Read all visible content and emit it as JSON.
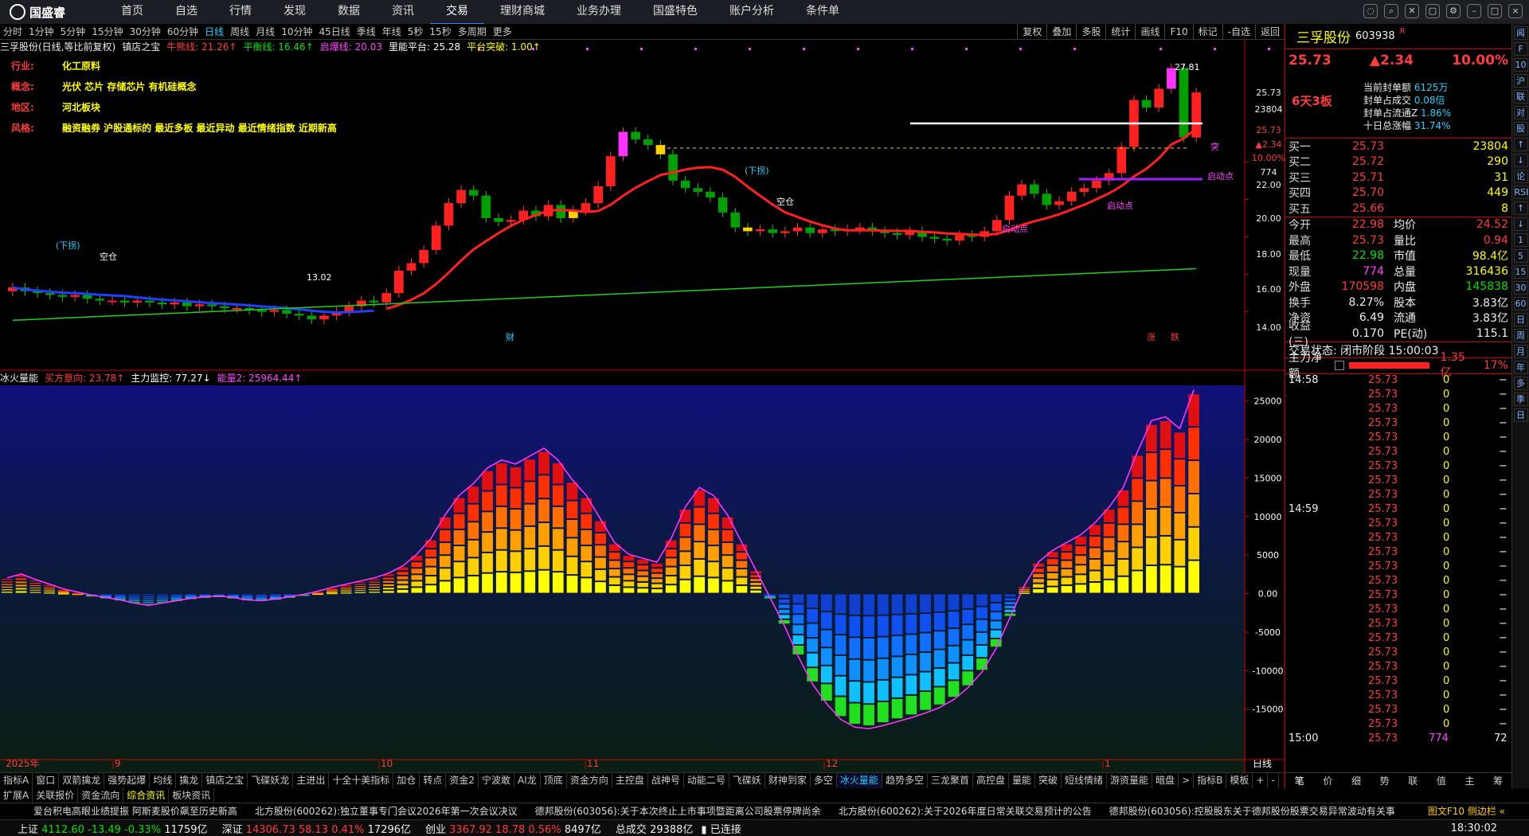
{
  "app": {
    "logo": "国盛睿"
  },
  "menu": [
    "首页",
    "自选",
    "行情",
    "发现",
    "数据",
    "资讯",
    "交易",
    "理财商城",
    "业务办理",
    "国盛特色",
    "账户分析",
    "条件单"
  ],
  "periods": [
    "分时",
    "1分钟",
    "5分钟",
    "15分钟",
    "30分钟",
    "60分钟",
    "日线",
    "周线",
    "月线",
    "10分钟",
    "45日线",
    "季线",
    "年线",
    "5秒",
    "15秒",
    "多周期",
    "更多"
  ],
  "right_tools": [
    "复权",
    "叠加",
    "多股",
    "统计",
    "画线",
    "F10",
    "标记",
    "-自选",
    "返回"
  ],
  "indicator1": {
    "name": "三孚股份(日线,等比前复权)",
    "addon": "镇店之宝",
    "lines": [
      {
        "label": "牛熊线: 21.26↑",
        "color": "#ff3b3b"
      },
      {
        "label": "平衡线: 16.46↑",
        "color": "#00e000"
      },
      {
        "label": "启爆线: 20.03",
        "color": "#ff44ff"
      },
      {
        "label": "里能平台: 25.28",
        "color": "#ffffff"
      },
      {
        "label": "平台突破: 1.00↑",
        "color": "#ffff00"
      }
    ]
  },
  "info": [
    {
      "k": "行业:",
      "v": "化工原料"
    },
    {
      "k": "概念:",
      "v": "光伏 芯片 存储芯片 有机硅概念"
    },
    {
      "k": "地区:",
      "v": "河北板块"
    },
    {
      "k": "风格:",
      "v": "融资融券 沪股通标的 最近多板 最近异动 最近情绪指数 近期新高"
    }
  ],
  "indicator2": {
    "name": "冰火量能",
    "lines": [
      {
        "label": "买方意向: 23.78↑",
        "color": "#ff3b3b"
      },
      {
        "label": "主力监控: 77.27↓",
        "color": "#ffffff"
      },
      {
        "label": "能量2: 25964.44↑",
        "color": "#ff44ff"
      }
    ]
  },
  "price_axis": [
    "25.73",
    "23804",
    "25.73",
    "▲2.34",
    "10.00%",
    "774",
    "22.00",
    "20.00",
    "18.00",
    "16.00",
    "14.00"
  ],
  "vol_axis": [
    "25000",
    "20000",
    "15000",
    "10000",
    "5000",
    "0.00",
    "-5000",
    "-10000",
    "-15000"
  ],
  "date_axis": [
    "2025年",
    "9",
    "10",
    "11",
    "12",
    "1",
    "日线"
  ],
  "chart_labels": {
    "high": "27.81",
    "low": "13.02",
    "downbreak1": "(下拐)",
    "downbreak2": "(下拐)",
    "empty1": "空仓",
    "empty2": "空仓",
    "start": "启动点",
    "start2": "启动点",
    "start3": "启动点",
    "tu": "突",
    "zhang": "涨",
    "die": "跌",
    "cai": "财",
    "gain_tag": "6天3板"
  },
  "chart_data": {
    "type": "candlestick",
    "title": "三孚股份(日线,等比前复权)",
    "ylim": [
      12.5,
      28
    ],
    "y_ticks": [
      14,
      16,
      18,
      20,
      22
    ],
    "closes": [
      15.3,
      15.1,
      15.0,
      14.9,
      14.8,
      14.9,
      14.7,
      14.6,
      14.6,
      14.5,
      14.6,
      14.5,
      14.4,
      14.5,
      14.3,
      14.4,
      14.3,
      14.2,
      14.2,
      14.1,
      14.0,
      14.1,
      13.9,
      13.8,
      13.6,
      13.8,
      14.0,
      14.3,
      14.6,
      14.5,
      15.0,
      16.2,
      16.6,
      17.3,
      18.6,
      19.8,
      20.5,
      20.2,
      19.0,
      18.8,
      18.9,
      19.4,
      19.1,
      19.7,
      19.0,
      19.4,
      19.8,
      20.7,
      22.3,
      23.6,
      23.2,
      22.9,
      22.4,
      21.0,
      20.6,
      20.4,
      20.1,
      19.3,
      18.5,
      18.3,
      18.4,
      18.2,
      18.3,
      18.5,
      18.2,
      18.4,
      18.3,
      18.4,
      18.5,
      18.3,
      18.2,
      18.1,
      18.3,
      18.0,
      17.9,
      17.8,
      18.1,
      18.0,
      18.3,
      18.9,
      20.2,
      20.8,
      20.3,
      19.7,
      19.9,
      20.4,
      20.6,
      21.0,
      21.4,
      22.8,
      25.3,
      24.9,
      25.9,
      27.0,
      23.3,
      25.7
    ],
    "energy": {
      "type": "bar",
      "x_label": "日线",
      "ylim": [
        -20000,
        26000
      ],
      "values": [
        2000,
        2500,
        1800,
        1200,
        600,
        200,
        -200,
        -500,
        -800,
        -1200,
        -1500,
        -1200,
        -900,
        -600,
        -400,
        -300,
        -500,
        -800,
        -900,
        -700,
        -400,
        -100,
        300,
        800,
        1200,
        1600,
        2000,
        2600,
        3500,
        5000,
        7000,
        10000,
        12500,
        14000,
        16000,
        17000,
        16500,
        17500,
        18500,
        17000,
        14500,
        12500,
        9500,
        6500,
        5000,
        4500,
        4000,
        7000,
        11000,
        13500,
        12500,
        10000,
        6500,
        3000,
        -500,
        -4000,
        -8000,
        -11500,
        -14000,
        -16000,
        -17000,
        -17200,
        -16800,
        -16300,
        -15800,
        -15200,
        -14500,
        -13500,
        -12000,
        -10000,
        -7000,
        -3000,
        1000,
        4000,
        5500,
        6500,
        7500,
        9000,
        11000,
        13500,
        18000,
        22000,
        22500,
        21000,
        25964
      ],
      "series": [
        {
          "name": "能量2",
          "last": 25964.44
        }
      ]
    }
  },
  "quote": {
    "name": "三孚股份",
    "code": "603938",
    "tag": "R",
    "price": "25.73",
    "change": "▲2.34",
    "pct": "10.00%",
    "seal": [
      {
        "k": "当前封单额",
        "v": "6125万"
      },
      {
        "k": "封单占成交",
        "v": "0.08倍"
      },
      {
        "k": "封单占流通Z",
        "v": "1.86%"
      },
      {
        "k": "十日总涨幅",
        "v": "31.74%"
      }
    ],
    "board": "6天3板",
    "book": [
      {
        "k": "买一",
        "p": "25.73",
        "v": "23804"
      },
      {
        "k": "买二",
        "p": "25.72",
        "v": "290"
      },
      {
        "k": "买三",
        "p": "25.71",
        "v": "31"
      },
      {
        "k": "买四",
        "p": "25.70",
        "v": "449"
      },
      {
        "k": "买五",
        "p": "25.66",
        "v": "8"
      }
    ],
    "stats": [
      {
        "a": "今开",
        "av": "22.98",
        "b": "均价",
        "bv": "24.52"
      },
      {
        "a": "最高",
        "av": "25.73",
        "b": "量比",
        "bv": "0.94"
      },
      {
        "a": "最低",
        "av": "22.98",
        "b": "市值",
        "bv": "98.4亿"
      },
      {
        "a": "现量",
        "av": "774",
        "b": "总量",
        "bv": "316436"
      },
      {
        "a": "外盘",
        "av": "170598",
        "b": "内盘",
        "bv": "145838"
      },
      {
        "a": "换手",
        "av": "8.27%",
        "b": "股本",
        "bv": "3.83亿"
      },
      {
        "a": "净资",
        "av": "6.49",
        "b": "流通",
        "bv": "3.83亿"
      },
      {
        "a": "收益(三)",
        "av": "0.170",
        "b": "PE(动)",
        "bv": "115.1"
      }
    ],
    "trade_state": "交易状态: 闭市阶段 15:00:03",
    "mainflow": {
      "k": "主力净额",
      "v": "1.35亿",
      "p": "17%"
    },
    "ticks_time": [
      "14:58",
      "14:59",
      "15:00"
    ],
    "tick_price": "25.73",
    "tick_vol": "0",
    "last_tick": {
      "p": "25.73",
      "v": "774",
      "n": "72"
    },
    "bottom_tabs": [
      "笔",
      "价",
      "细",
      "势",
      "联",
      "值",
      "主",
      "筹"
    ]
  },
  "sidebar": [
    "闻",
    "F",
    "10",
    "沪",
    "联",
    "对",
    "股",
    "↑",
    "↓",
    "论",
    "RSI",
    "↑",
    "↓",
    "1",
    "5",
    "15",
    "30",
    "60",
    "日",
    "周",
    "月",
    "年",
    "多",
    "季",
    "日"
  ],
  "tabs": [
    "指标A",
    "窗口",
    "双箭擒龙",
    "强势起爆",
    "均线",
    "擒龙",
    "镇店之宝",
    "飞碟妖龙",
    "主进出",
    "十全十美指标",
    "加仓",
    "转点",
    "资金2",
    "宁波敢",
    "AI龙",
    "顶底",
    "资金方向",
    "主控盘",
    "战神号",
    "动能二号",
    "飞碟妖",
    "财神到家",
    "多空",
    "冰火量能",
    "趋势多空",
    "三龙聚首",
    "高控盘",
    "量能",
    "突破",
    "短线情绪",
    "游资量能",
    "暗盘",
    ">",
    "指标B",
    "模板",
    "+",
    "-"
  ],
  "tabs2": [
    "扩展A",
    "关联报价",
    "资金流向",
    "综合资讯",
    "板块资讯"
  ],
  "news": [
    "爱台积电高眼业绩提振 阿斯麦股价飙至历史新高",
    "北方股份(600262):独立董事专门会议2026年第一次会议决议",
    "德邦股份(603056):关于本次终止上市事项暨距离公司股票停牌尚余",
    "北方股份(600262):关于2026年度日常关联交易预计的公告",
    "德邦股份(603056):控股股东关于德邦股份股票交易异常波动有关事"
  ],
  "news_tail": "图文F10 侧边栏 «",
  "status": [
    {
      "n": "上证",
      "v": "4112.60",
      "c": "-13.49",
      "p": "-0.33%",
      "a": "11759亿"
    },
    {
      "n": "深证",
      "v": "14306.73",
      "c": "58.13",
      "p": "0.41%",
      "a": "17296亿"
    },
    {
      "n": "创业",
      "v": "3367.92",
      "c": "18.78",
      "p": "0.56%",
      "a": "8497亿"
    }
  ],
  "turnover": {
    "k": "总成交",
    "v": "29388亿"
  },
  "conn": "已连接",
  "clock": "18:30:02"
}
